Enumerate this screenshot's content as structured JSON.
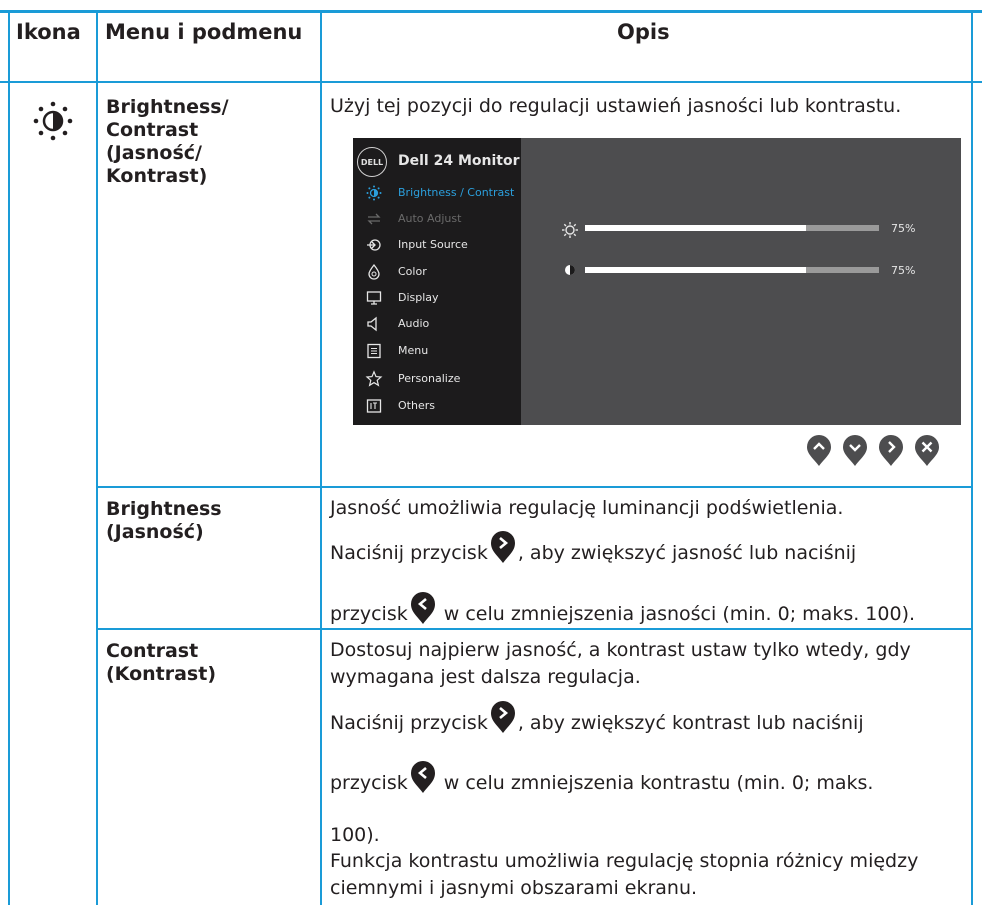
{
  "table": {
    "headers": {
      "icon": "Ikona",
      "menu": "Menu i podmenu",
      "desc": "Opis"
    },
    "rows": [
      {
        "menu_lines": [
          "Brightness/",
          "Contrast",
          "(Jasność/",
          "Kontrast)"
        ],
        "desc": "Użyj tej pozycji do regulacji ustawień jasności lub kontrastu."
      },
      {
        "menu_lines": [
          "Brightness",
          "(Jasność)"
        ],
        "desc_line1": "Jasność umożliwia regulację luminancji podświetlenia.",
        "desc_line2a": "Naciśnij przycisk",
        "desc_line2b": ", aby zwiększyć jasność lub naciśnij",
        "desc_line3a": "przycisk",
        "desc_line3b": " w celu zmniejszenia jasności (min. 0; maks. 100)."
      },
      {
        "menu_lines": [
          "Contrast",
          "(Kontrast)"
        ],
        "desc_line1": "Dostosuj najpierw jasność, a kontrast ustaw tylko wtedy, gdy",
        "desc_line2": "wymagana jest dalsza regulacja.",
        "desc_line3a": "Naciśnij przycisk",
        "desc_line3b": ", aby zwiększyć kontrast lub naciśnij",
        "desc_line4a": "przycisk",
        "desc_line4b": " w celu zmniejszenia kontrastu (min. 0; maks.",
        "desc_line5": "100).",
        "desc_line6": "Funkcja kontrastu umożliwia regulację stopnia różnicy między",
        "desc_line7": "ciemnymi i jasnymi obszarami ekranu."
      }
    ]
  },
  "osd": {
    "logo": "DELL",
    "title": "Dell 24 Monitor",
    "items": [
      {
        "label": "Brightness / Contrast",
        "icon": "brightness-icon",
        "state": "active"
      },
      {
        "label": "Auto Adjust",
        "icon": "auto-adjust-icon",
        "state": "disabled"
      },
      {
        "label": "Input Source",
        "icon": "input-source-icon",
        "state": "normal"
      },
      {
        "label": "Color",
        "icon": "color-icon",
        "state": "normal"
      },
      {
        "label": "Display",
        "icon": "display-icon",
        "state": "normal"
      },
      {
        "label": "Audio",
        "icon": "audio-icon",
        "state": "normal"
      },
      {
        "label": "Menu",
        "icon": "menu-icon",
        "state": "normal"
      },
      {
        "label": "Personalize",
        "icon": "personalize-icon",
        "state": "normal"
      },
      {
        "label": "Others",
        "icon": "others-icon",
        "state": "normal"
      }
    ],
    "brightness": {
      "value": 0.75,
      "label": "75%"
    },
    "contrast": {
      "value": 0.75,
      "label": "75%"
    },
    "nav_buttons": [
      "up-icon",
      "down-icon",
      "right-icon",
      "close-icon"
    ]
  },
  "colors": {
    "rule": "#1a9bd7",
    "osd_bg": "#4d4d4f",
    "osd_menu": "#1c1b1c",
    "accent": "#2b9fdc"
  }
}
